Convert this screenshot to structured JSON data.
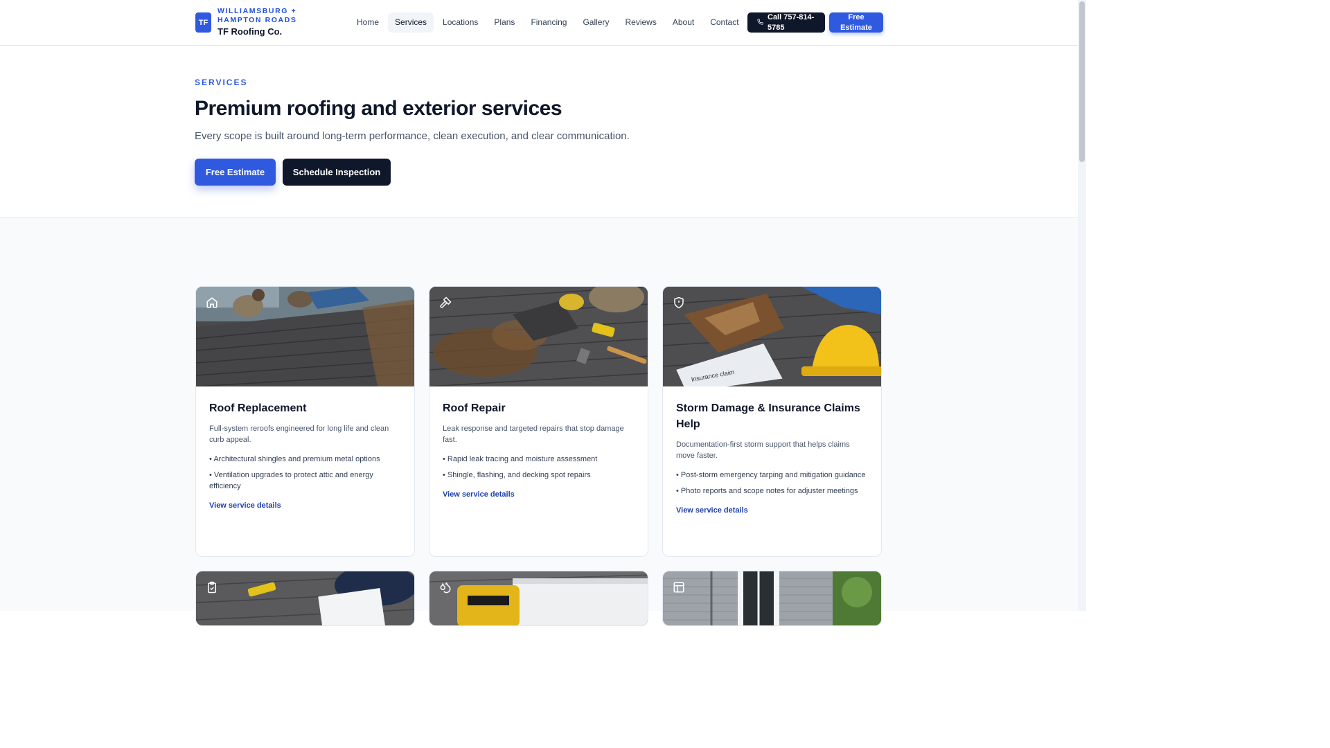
{
  "header": {
    "logo_initials": "TF",
    "region": "WILLIAMSBURG + HAMPTON ROADS",
    "company": "TF Roofing Co.",
    "nav": [
      {
        "label": "Home",
        "active": false
      },
      {
        "label": "Services",
        "active": true
      },
      {
        "label": "Locations",
        "active": false
      },
      {
        "label": "Plans",
        "active": false
      },
      {
        "label": "Financing",
        "active": false
      },
      {
        "label": "Gallery",
        "active": false
      },
      {
        "label": "Reviews",
        "active": false
      },
      {
        "label": "About",
        "active": false
      },
      {
        "label": "Contact",
        "active": false
      }
    ],
    "call_label": "Call 757-814-5785",
    "estimate_label": "Free Estimate"
  },
  "hero": {
    "eyebrow": "SERVICES",
    "title": "Premium roofing and exterior services",
    "subtitle": "Every scope is built around long-term performance, clean execution, and clear communication.",
    "primary_cta": "Free Estimate",
    "secondary_cta": "Schedule Inspection"
  },
  "services": [
    {
      "icon": "home-icon",
      "title": "Roof Replacement",
      "description": "Full-system reroofs engineered for long life and clean curb appeal.",
      "bullets": [
        "Architectural shingles and premium metal options",
        "Ventilation upgrades to protect attic and energy efficiency"
      ],
      "link": "View service details"
    },
    {
      "icon": "hammer-icon",
      "title": "Roof Repair",
      "description": "Leak response and targeted repairs that stop damage fast.",
      "bullets": [
        "Rapid leak tracing and moisture assessment",
        "Shingle, flashing, and decking spot repairs"
      ],
      "link": "View service details"
    },
    {
      "icon": "shield-icon",
      "title": "Storm Damage & Insurance Claims Help",
      "description": "Documentation-first storm support that helps claims move faster.",
      "bullets": [
        "Post-storm emergency tarping and mitigation guidance",
        "Photo reports and scope notes for adjuster meetings"
      ],
      "link": "View service details"
    }
  ],
  "lower_cards": [
    {
      "icon": "clipboard-check-icon"
    },
    {
      "icon": "droplets-icon"
    },
    {
      "icon": "panel-layout-icon"
    }
  ],
  "colors": {
    "accent": "#2f5ae0",
    "dark": "#0f172a",
    "link": "#1e40af"
  }
}
